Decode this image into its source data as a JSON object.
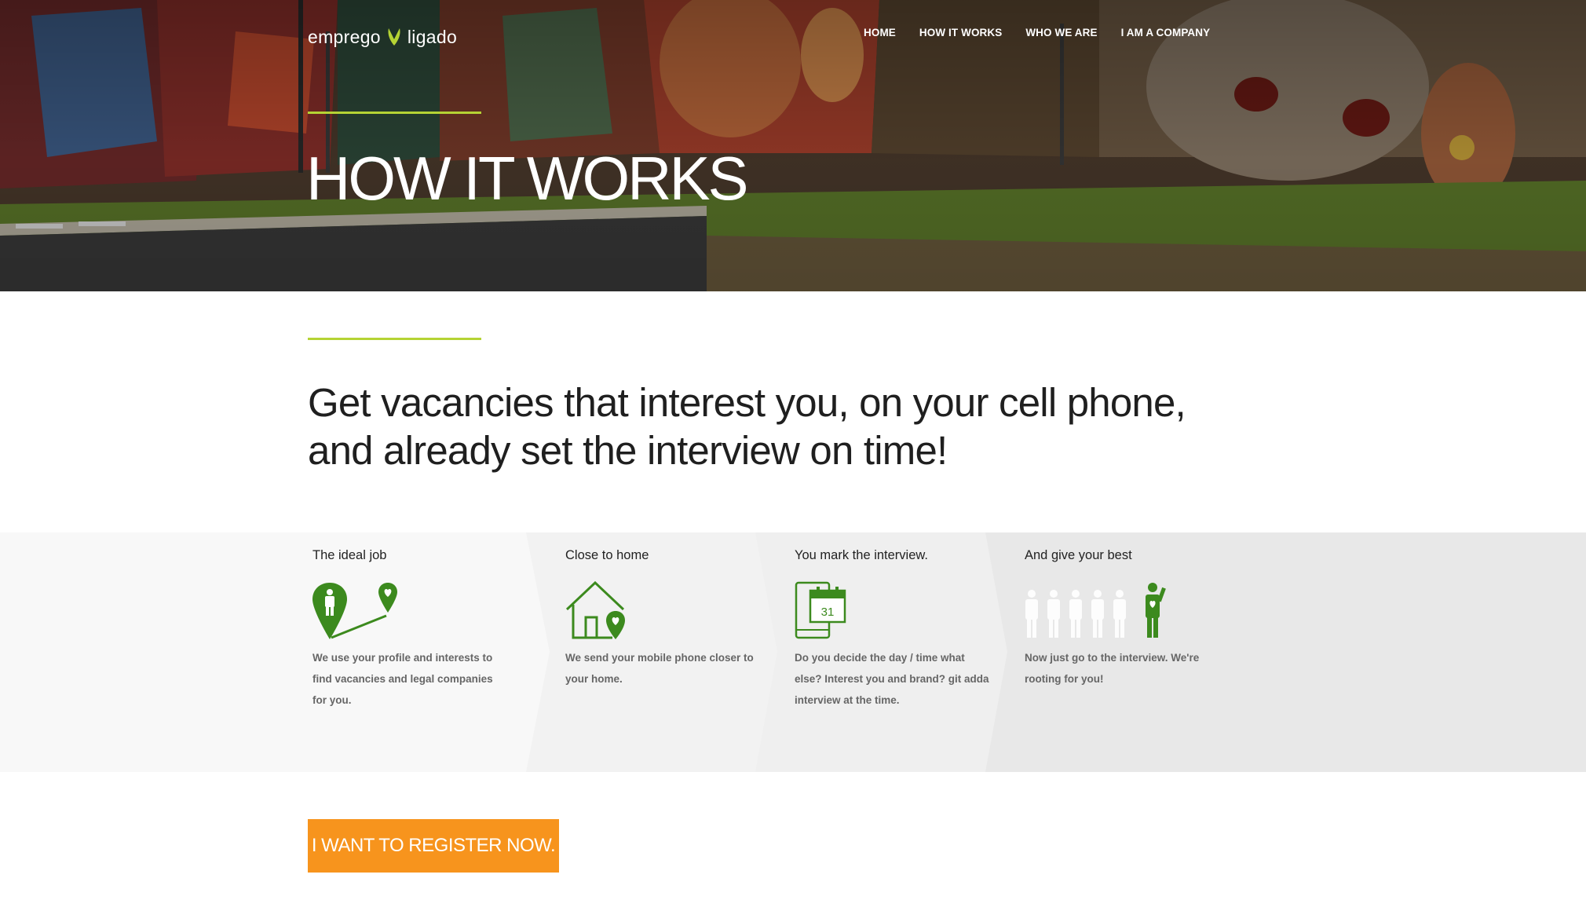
{
  "header": {
    "logo_left": "emprego",
    "logo_right": "ligado",
    "nav": [
      "HOME",
      "HOW IT WORKS",
      "WHO WE ARE",
      "I AM A COMPANY"
    ]
  },
  "hero": {
    "title": "HOW IT WORKS"
  },
  "intro": {
    "text": "Get vacancies that interest you, on your cell phone, and already set the interview on time!"
  },
  "steps": [
    {
      "title": "The ideal job",
      "description": "We use your profile and interests to find vacancies and legal companies for you.",
      "icon": "map-pins-icon"
    },
    {
      "title": "Close to home",
      "description": "We send your mobile phone closer to your home.",
      "icon": "house-pin-icon"
    },
    {
      "title": "You mark the interview.",
      "description": "Do you decide the day / time what else? Interest you and brand? git adda interview at the time.",
      "icon": "phone-calendar-icon",
      "calendar_day": "31"
    },
    {
      "title": "And give your best",
      "description": "Now just go to the interview. We're rooting for you!",
      "icon": "people-queue-icon"
    }
  ],
  "cta": {
    "label": "I WANT TO REGISTER NOW."
  },
  "colors": {
    "accent_green": "#b5d334",
    "icon_green": "#3c8a1e",
    "cta_orange": "#f7941d"
  }
}
